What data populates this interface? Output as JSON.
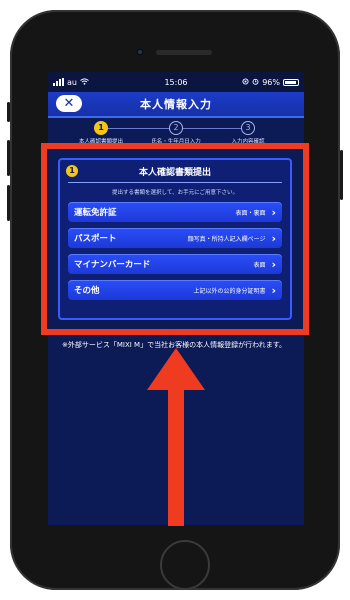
{
  "status_bar": {
    "carrier": "au",
    "time": "15:06",
    "battery": "96%"
  },
  "app_bar": {
    "close_label": "✕",
    "title": "本人情報入力"
  },
  "stepper": [
    {
      "number": "1",
      "label": "本人確認書類提出",
      "active": true
    },
    {
      "number": "2",
      "label": "氏名・生年月日入力",
      "active": false
    },
    {
      "number": "3",
      "label": "入力内容確認",
      "active": false
    }
  ],
  "card": {
    "badge": "1",
    "title": "本人確認書類提出",
    "subtitle": "提出する書類を選択して、お手元にご用意下さい。",
    "items": [
      {
        "name": "運転免許証",
        "detail": "表面・裏面"
      },
      {
        "name": "パスポート",
        "detail": "顔写真・所持人記入欄ページ"
      },
      {
        "name": "マイナンバーカード",
        "detail": "表面"
      },
      {
        "name": "その他",
        "detail": "上記以外の公的身分証明書"
      }
    ]
  },
  "note": {
    "text": "※外部サービス「MIXI M」で当社お客様の本人情報登録が行われます。"
  },
  "colors": {
    "screen_bg": "#0c1a55",
    "button_blue": "#2a4ef8",
    "accent_yellow": "#f5c518",
    "annotation_red": "#ef3b1f"
  }
}
